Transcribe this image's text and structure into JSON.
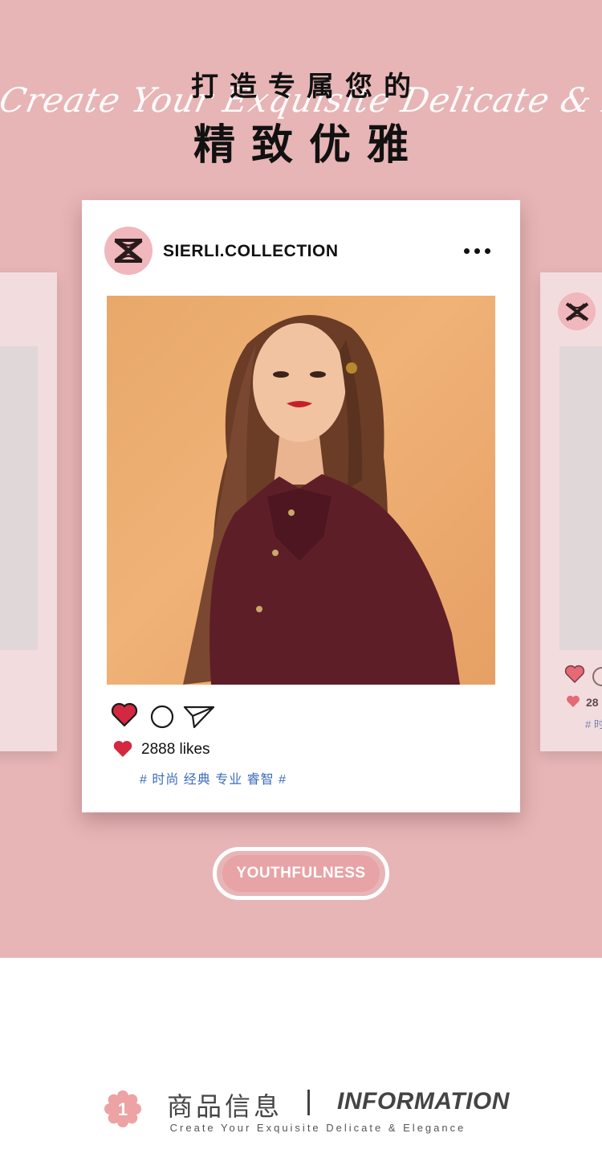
{
  "header": {
    "title_line1": "打造专属您的",
    "title_line2": "精致优雅",
    "script_text": "Create Your Exquisite Delicate & Elegance"
  },
  "post": {
    "account_name": "SIERLI.COLLECTION",
    "likes_text": "2888 likes",
    "hashtags": "# 时尚 经典 专业 睿智 #",
    "icons": {
      "avatar": "brand-logo-icon",
      "more": "more-dots-icon",
      "like": "heart-icon",
      "comment": "comment-circle-icon",
      "share": "paper-plane-icon"
    }
  },
  "side_card_right": {
    "likes_fragment": "28",
    "tags_fragment": "# 时"
  },
  "tag_button": {
    "label": "YOUTHFULNESS"
  },
  "section_heading": {
    "number": "1",
    "title_cn": "商品信息",
    "title_en": "INFORMATION",
    "subtitle": "Create Your Exquisite Delicate & Elegance"
  },
  "colors": {
    "background_pink": "#e7b5b6",
    "heart_red": "#d3283f",
    "hashtag_blue": "#3c6dbb",
    "pill_fill": "#e7a3a6",
    "avatar_pink": "#f0b7bd"
  }
}
